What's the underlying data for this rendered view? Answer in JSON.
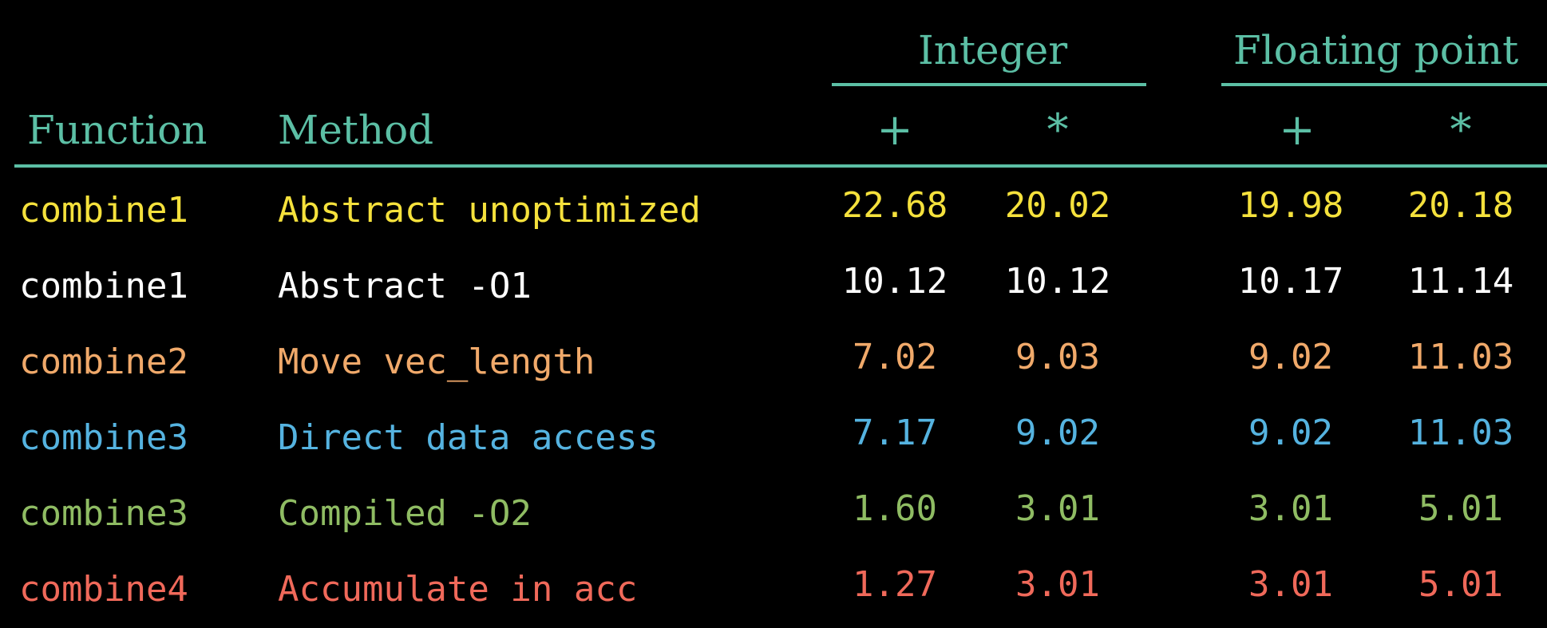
{
  "chart_data": {
    "type": "table",
    "group_headers": [
      "Integer",
      "Floating point"
    ],
    "column_headers": {
      "function": "Function",
      "method": "Method",
      "ops": [
        "+",
        "*",
        "+",
        "*"
      ]
    },
    "rows": [
      {
        "function": "combine1",
        "method": "Abstract unoptimized",
        "values": [
          "22.68",
          "20.02",
          "19.98",
          "20.18"
        ],
        "color": "#f5e13c"
      },
      {
        "function": "combine1",
        "method": "Abstract -O1",
        "values": [
          "10.12",
          "10.12",
          "10.17",
          "11.14"
        ],
        "color": "#ffffff"
      },
      {
        "function": "combine2",
        "method": "Move vec_length",
        "values": [
          "7.02",
          "9.03",
          "9.02",
          "11.03"
        ],
        "color": "#f0a96a"
      },
      {
        "function": "combine3",
        "method": "Direct data access",
        "values": [
          "7.17",
          "9.02",
          "9.02",
          "11.03"
        ],
        "color": "#55b3e0"
      },
      {
        "function": "combine3",
        "method": "Compiled -O2",
        "values": [
          "1.60",
          "3.01",
          "3.01",
          "5.01"
        ],
        "color": "#8fbc63"
      },
      {
        "function": "combine4",
        "method": "Accumulate in acc",
        "values": [
          "1.27",
          "3.01",
          "3.01",
          "5.01"
        ],
        "color": "#f0695a"
      }
    ]
  },
  "theme": {
    "header_color": "#5cbfa5",
    "background": "#000000"
  }
}
